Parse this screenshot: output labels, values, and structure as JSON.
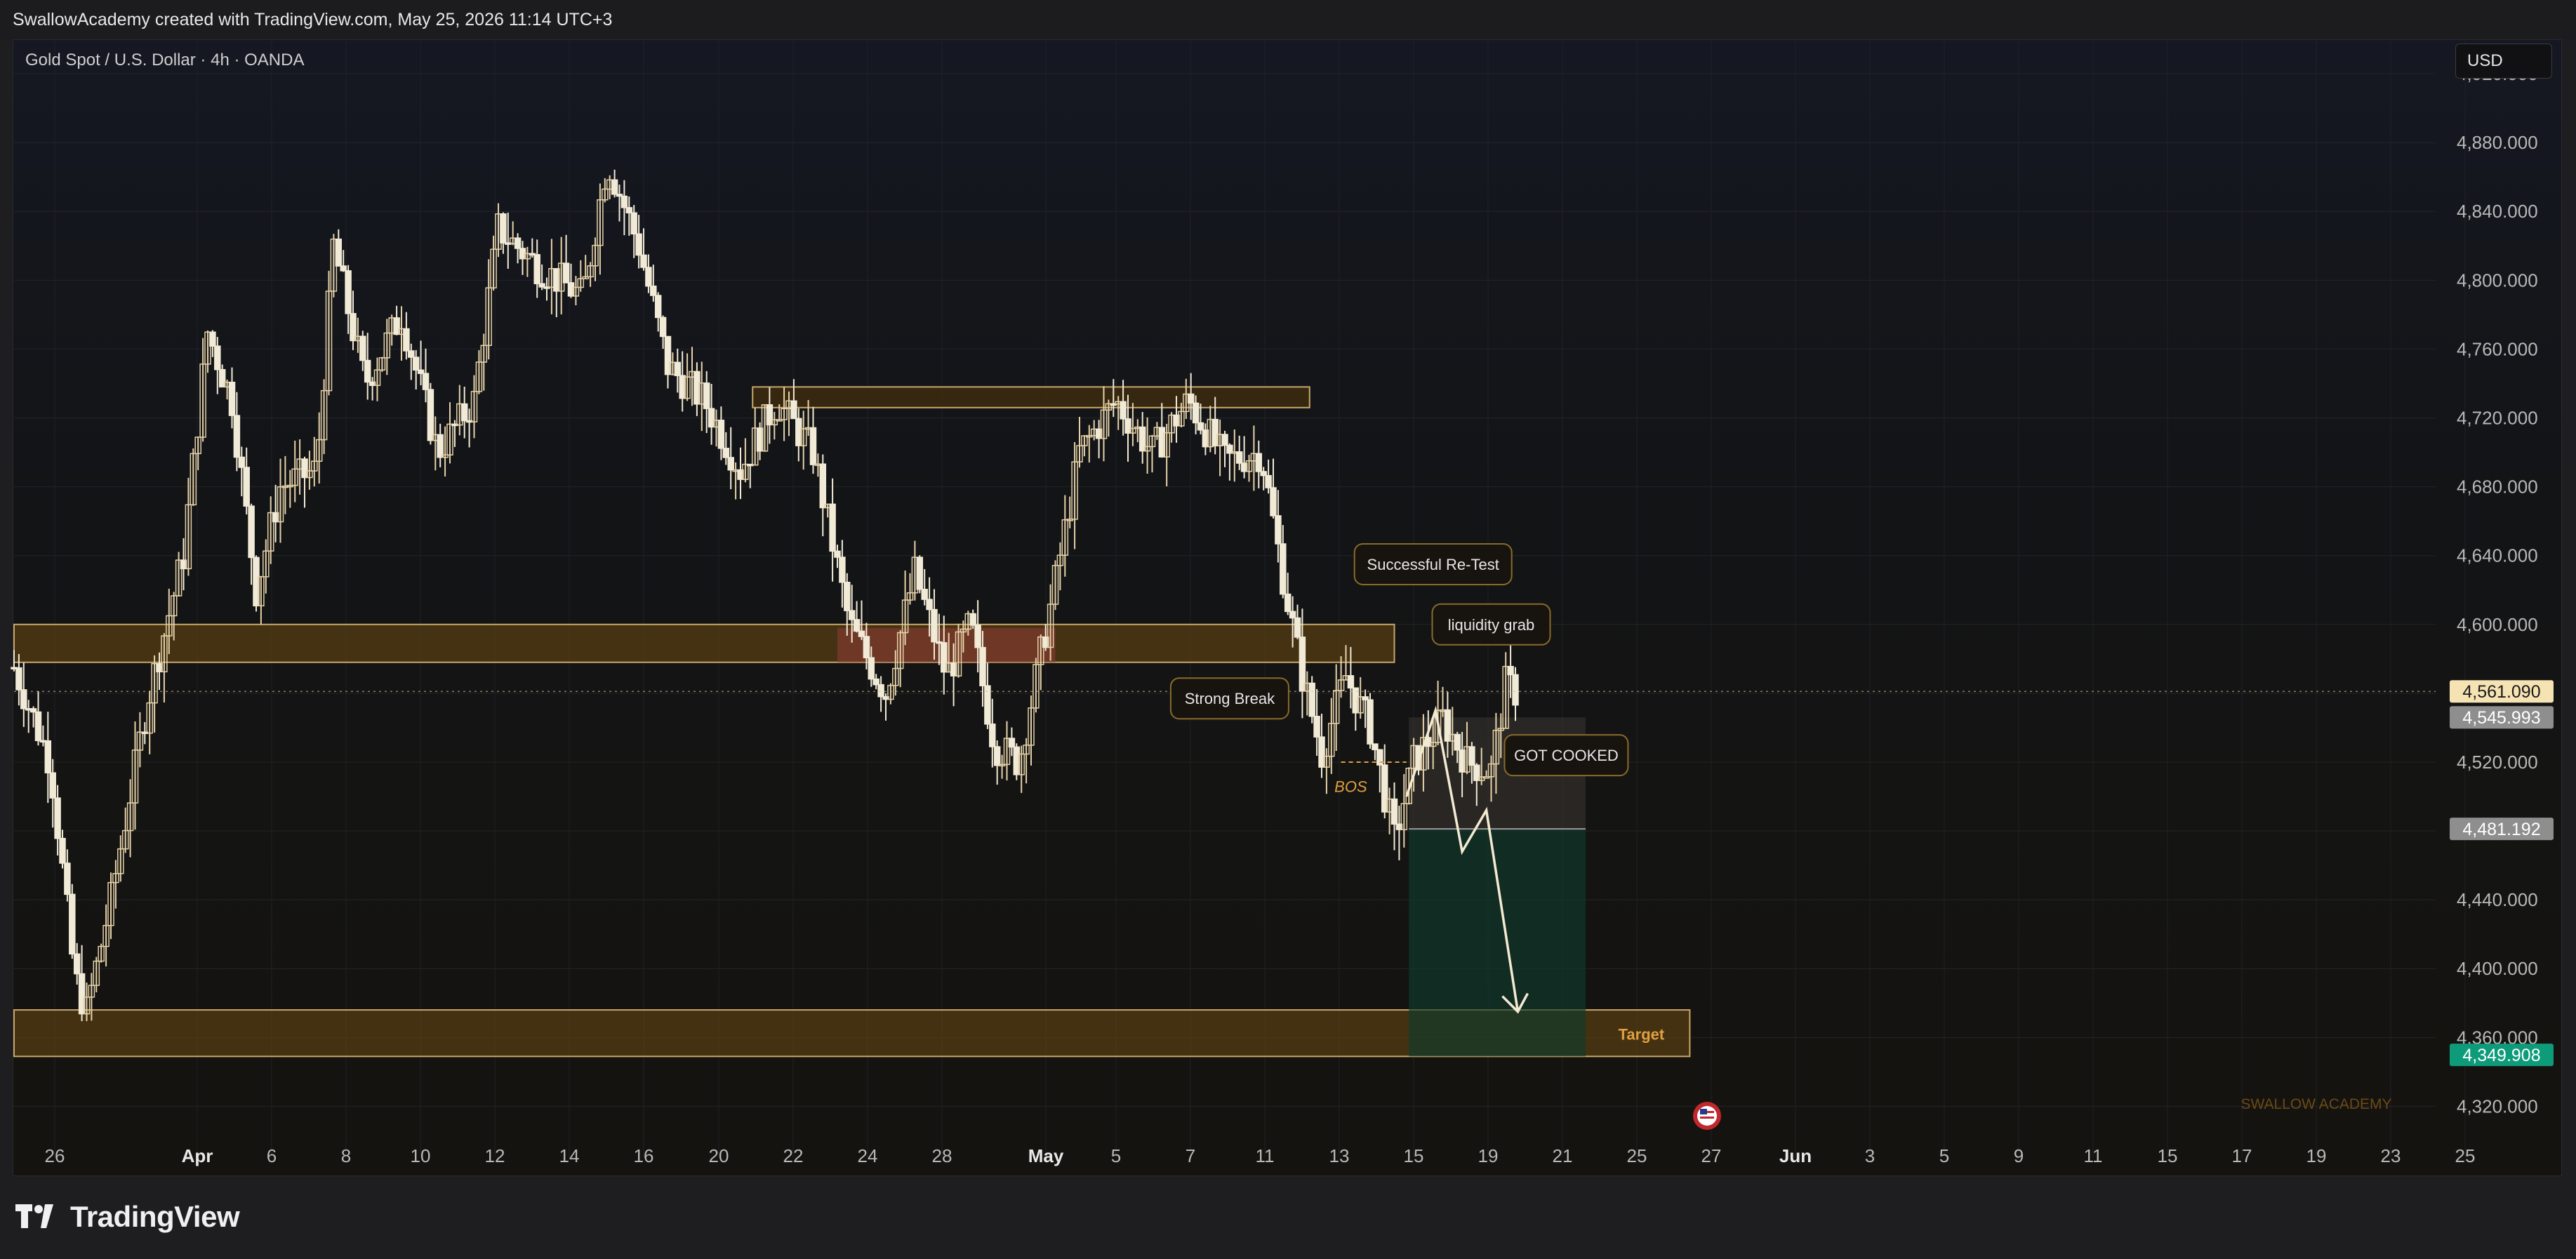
{
  "header": {
    "attribution": "SwallowAcademy created with TradingView.com, May 25, 2026 11:14 UTC+3"
  },
  "symbol": {
    "title": "Gold Spot / U.S. Dollar · 4h · OANDA"
  },
  "currency_selector": {
    "label": "USD"
  },
  "branding": {
    "logo_text": "TradingView",
    "watermark": "SWALLOW ACADEMY"
  },
  "colors": {
    "up_candle": "#e6d2a8",
    "down_candle": "#f1ead6",
    "zone_fill": "#6b4a12",
    "zone_border": "#c9a76a",
    "resistance_zone": "#3b2a10",
    "red_zone": "#8a3a33",
    "target_box": "#0f3a2c",
    "label_border": "#8a6a2a",
    "price_tag_gold": "#f6e3b4",
    "price_tag_gray": "#8e8e8e",
    "price_tag_green": "#0e9b7a",
    "accent_orange": "#e0a040"
  },
  "chart_data": {
    "type": "candlestick",
    "title": "Gold Spot / U.S. Dollar · 4h · OANDA",
    "ylim": [
      4290,
      4940
    ],
    "y_ticks": [
      "4,320.000",
      "4,360.000",
      "4,400.000",
      "4,440.000",
      "4,480.000",
      "4,520.000",
      "4,560.000",
      "4,600.000",
      "4,640.000",
      "4,680.000",
      "4,720.000",
      "4,760.000",
      "4,800.000",
      "4,840.000",
      "4,880.000",
      "4,920.000"
    ],
    "x_ticks": [
      "26",
      "Apr",
      "6",
      "8",
      "10",
      "12",
      "14",
      "16",
      "20",
      "22",
      "24",
      "28",
      "May",
      "5",
      "7",
      "11",
      "13",
      "15",
      "19",
      "21",
      "25",
      "27",
      "Jun",
      "3",
      "5",
      "9",
      "11",
      "15",
      "17",
      "19",
      "23",
      "25"
    ],
    "price_tags": [
      {
        "label": "4,561.090",
        "value": 4561.09,
        "style": "gold"
      },
      {
        "label": "4,545.993",
        "value": 4545.993,
        "style": "gray"
      },
      {
        "label": "4,481.192",
        "value": 4481.192,
        "style": "gray"
      },
      {
        "label": "4,349.908",
        "value": 4349.908,
        "style": "green"
      }
    ],
    "zones": [
      {
        "name": "top-resistance",
        "x": [
          0.305,
          0.535
        ],
        "y": [
          4726,
          4738
        ]
      },
      {
        "name": "broken-support",
        "x": [
          0.0,
          0.57
        ],
        "y": [
          4578,
          4600
        ]
      },
      {
        "name": "red-block",
        "x": [
          0.34,
          0.43
        ],
        "y": [
          4578,
          4598
        ]
      },
      {
        "name": "target-zone",
        "x": [
          0.0,
          0.692
        ],
        "y": [
          4349,
          4376
        ]
      },
      {
        "name": "short-risk",
        "x": [
          0.576,
          0.649
        ],
        "y": [
          4481,
          4546
        ]
      },
      {
        "name": "short-reward",
        "x": [
          0.576,
          0.649
        ],
        "y": [
          4349,
          4481
        ]
      }
    ],
    "annotations": [
      {
        "text": "Successful Re-Test",
        "x": 0.586,
        "y": 4635
      },
      {
        "text": "liquidity grab",
        "x": 0.61,
        "y": 4600
      },
      {
        "text": "Strong Break",
        "x": 0.502,
        "y": 4557
      },
      {
        "text": "GOT COOKED",
        "x": 0.641,
        "y": 4524
      },
      {
        "text": "BOS",
        "x": 0.552,
        "y": 4506
      },
      {
        "text": "Target",
        "x": 0.672,
        "y": 4362
      }
    ],
    "path_projection": [
      {
        "x": 0.575,
        "y": 4500
      },
      {
        "x": 0.587,
        "y": 4550
      },
      {
        "x": 0.598,
        "y": 4468
      },
      {
        "x": 0.608,
        "y": 4492
      },
      {
        "x": 0.621,
        "y": 4375
      }
    ],
    "ohlc_anchors": [
      {
        "t": 0.0,
        "p": 4575
      },
      {
        "t": 0.015,
        "p": 4520
      },
      {
        "t": 0.025,
        "p": 4395
      },
      {
        "t": 0.03,
        "p": 4375
      },
      {
        "t": 0.04,
        "p": 4440
      },
      {
        "t": 0.055,
        "p": 4555
      },
      {
        "t": 0.07,
        "p": 4640
      },
      {
        "t": 0.08,
        "p": 4770
      },
      {
        "t": 0.09,
        "p": 4730
      },
      {
        "t": 0.1,
        "p": 4620
      },
      {
        "t": 0.11,
        "p": 4680
      },
      {
        "t": 0.125,
        "p": 4690
      },
      {
        "t": 0.132,
        "p": 4820
      },
      {
        "t": 0.145,
        "p": 4740
      },
      {
        "t": 0.16,
        "p": 4780
      },
      {
        "t": 0.175,
        "p": 4700
      },
      {
        "t": 0.19,
        "p": 4730
      },
      {
        "t": 0.2,
        "p": 4830
      },
      {
        "t": 0.215,
        "p": 4810
      },
      {
        "t": 0.235,
        "p": 4790
      },
      {
        "t": 0.245,
        "p": 4870
      },
      {
        "t": 0.258,
        "p": 4820
      },
      {
        "t": 0.27,
        "p": 4750
      },
      {
        "t": 0.285,
        "p": 4730
      },
      {
        "t": 0.3,
        "p": 4690
      },
      {
        "t": 0.315,
        "p": 4730
      },
      {
        "t": 0.33,
        "p": 4700
      },
      {
        "t": 0.345,
        "p": 4600
      },
      {
        "t": 0.36,
        "p": 4560
      },
      {
        "t": 0.372,
        "p": 4630
      },
      {
        "t": 0.385,
        "p": 4570
      },
      {
        "t": 0.395,
        "p": 4600
      },
      {
        "t": 0.405,
        "p": 4530
      },
      {
        "t": 0.415,
        "p": 4520
      },
      {
        "t": 0.428,
        "p": 4610
      },
      {
        "t": 0.44,
        "p": 4700
      },
      {
        "t": 0.455,
        "p": 4730
      },
      {
        "t": 0.47,
        "p": 4700
      },
      {
        "t": 0.485,
        "p": 4730
      },
      {
        "t": 0.5,
        "p": 4695
      },
      {
        "t": 0.515,
        "p": 4700
      },
      {
        "t": 0.525,
        "p": 4620
      },
      {
        "t": 0.532,
        "p": 4570
      },
      {
        "t": 0.54,
        "p": 4525
      },
      {
        "t": 0.55,
        "p": 4570
      },
      {
        "t": 0.56,
        "p": 4540
      },
      {
        "t": 0.57,
        "p": 4475
      },
      {
        "t": 0.578,
        "p": 4520
      },
      {
        "t": 0.59,
        "p": 4545
      },
      {
        "t": 0.6,
        "p": 4520
      },
      {
        "t": 0.61,
        "p": 4515
      },
      {
        "t": 0.616,
        "p": 4565
      },
      {
        "t": 0.62,
        "p": 4561
      }
    ]
  }
}
